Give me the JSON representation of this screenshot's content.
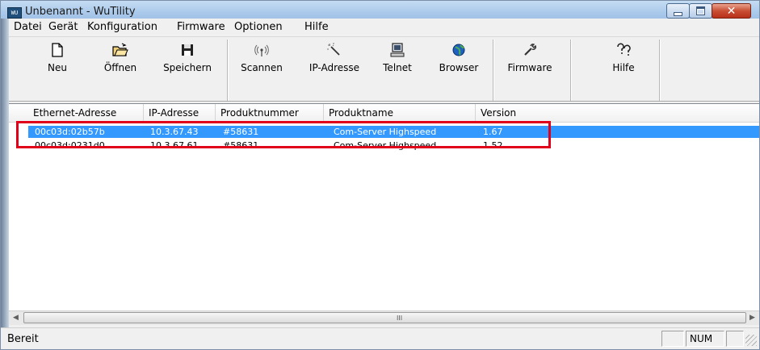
{
  "window": {
    "app_icon_text": "WU",
    "title": "Unbenannt - WuTility"
  },
  "menu": {
    "items": [
      "Datei",
      "Gerät",
      "Konfiguration",
      "Firmware",
      "Optionen",
      "Hilfe"
    ]
  },
  "toolbar": {
    "buttons": [
      {
        "label": "Neu",
        "icon": "new-document-icon"
      },
      {
        "label": "Öffnen",
        "icon": "open-folder-icon"
      },
      {
        "label": "Speichern",
        "icon": "save-disk-icon"
      },
      {
        "label": "Scannen",
        "icon": "scan-antenna-icon"
      },
      {
        "label": "IP-Adresse",
        "icon": "ip-address-wand-icon"
      },
      {
        "label": "Telnet",
        "icon": "telnet-terminal-icon"
      },
      {
        "label": "Browser",
        "icon": "browser-globe-icon"
      },
      {
        "label": "Firmware",
        "icon": "firmware-wrench-icon"
      },
      {
        "label": "Hilfe",
        "icon": "help-icon"
      }
    ]
  },
  "table": {
    "columns": [
      "Ethernet-Adresse",
      "IP-Adresse",
      "Produktnummer",
      "Produktname",
      "Version"
    ],
    "rows": [
      {
        "ethernet": "00c03d:02b57b",
        "ip": "10.3.67.43",
        "product_no": "#58631",
        "product_name": "Com-Server Highspeed",
        "version": "1.67",
        "selected": true
      },
      {
        "ethernet": "00c03d:0231d0",
        "ip": "10.3.67.61",
        "product_no": "#58631",
        "product_name": "Com-Server Highspeed",
        "version": "1.52",
        "selected": false
      }
    ]
  },
  "scrollbar": {
    "grip": "III"
  },
  "status": {
    "text": "Bereit",
    "panes": [
      "",
      "NUM",
      ""
    ]
  },
  "colors": {
    "selection": "#3399ff",
    "highlight_box": "#e0001a",
    "close_button": "#c94f34"
  }
}
